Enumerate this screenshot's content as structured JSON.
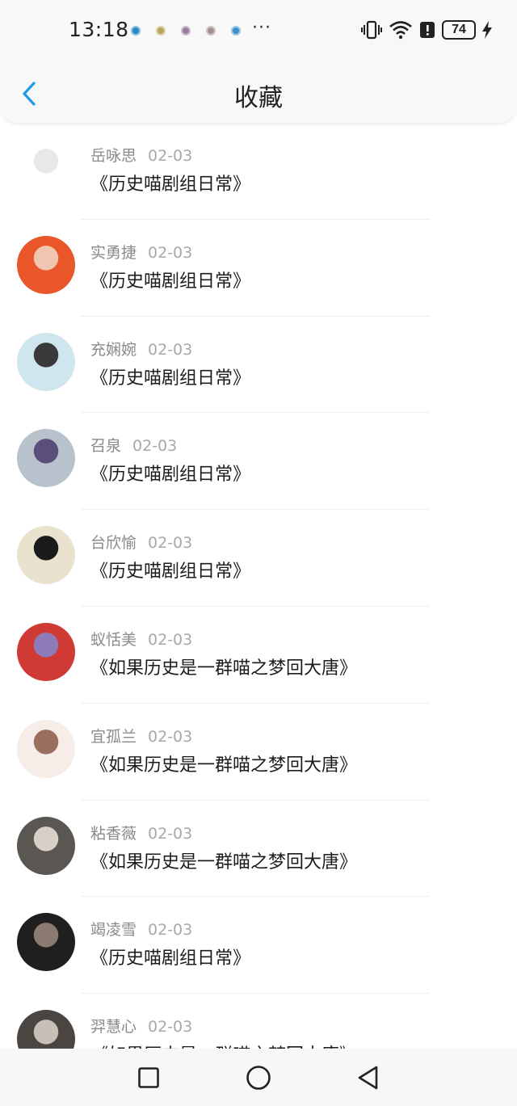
{
  "status_bar": {
    "time": "13:18",
    "more": "···",
    "battery": "74",
    "notif_colors": [
      "#2a86c8",
      "#b8a65a",
      "#9a7f9a",
      "#a48e8e",
      "#3a92c8"
    ],
    "icons": [
      "vibrate-icon",
      "wifi-icon",
      "alert-icon",
      "battery-icon",
      "charging-icon"
    ]
  },
  "header": {
    "title": "收藏",
    "back_icon": "chevron-left-icon",
    "accent": "#1e9be4"
  },
  "items": [
    {
      "user": "岳咏思",
      "date": "02-03",
      "title": "《历史喵剧组日常》",
      "avatar_colors": [
        "#ffffff",
        "#e8e8e8"
      ]
    },
    {
      "user": "实勇捷",
      "date": "02-03",
      "title": "《历史喵剧组日常》",
      "avatar_colors": [
        "#e8562a",
        "#f1c6b0"
      ]
    },
    {
      "user": "充娴婉",
      "date": "02-03",
      "title": "《历史喵剧组日常》",
      "avatar_colors": [
        "#cfe6ee",
        "#3a3a3a"
      ]
    },
    {
      "user": "召泉",
      "date": "02-03",
      "title": "《历史喵剧组日常》",
      "avatar_colors": [
        "#b7c2cc",
        "#5a4e7a"
      ]
    },
    {
      "user": "台欣愉",
      "date": "02-03",
      "title": "《历史喵剧组日常》",
      "avatar_colors": [
        "#e9e2cf",
        "#1a1a1a"
      ]
    },
    {
      "user": "蚁恬美",
      "date": "02-03",
      "title": "《如果历史是一群喵之梦回大唐》",
      "avatar_colors": [
        "#cf3b34",
        "#8e7cb8"
      ]
    },
    {
      "user": "宜孤兰",
      "date": "02-03",
      "title": "《如果历史是一群喵之梦回大唐》",
      "avatar_colors": [
        "#f6ece8",
        "#9a6f5e"
      ]
    },
    {
      "user": "粘香薇",
      "date": "02-03",
      "title": "《如果历史是一群喵之梦回大唐》",
      "avatar_colors": [
        "#5a5652",
        "#d8cfc6"
      ]
    },
    {
      "user": "竭凌雪",
      "date": "02-03",
      "title": "《历史喵剧组日常》",
      "avatar_colors": [
        "#1f1f1f",
        "#8a7a70"
      ]
    },
    {
      "user": "羿慧心",
      "date": "02-03",
      "title": "《如果历史是一群喵之梦回大唐》",
      "avatar_colors": [
        "#4a4541",
        "#c8bfb6"
      ]
    }
  ],
  "system_nav": {
    "recent_icon": "square-icon",
    "home_icon": "circle-icon",
    "back_icon": "triangle-back-icon"
  }
}
